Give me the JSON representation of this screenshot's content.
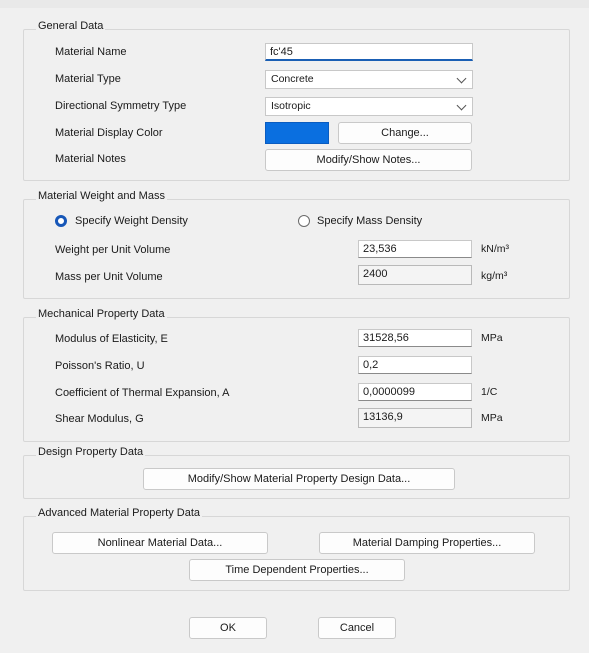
{
  "general": {
    "title": "General Data",
    "material_name_label": "Material Name",
    "material_name_value": "fc'45",
    "material_type_label": "Material Type",
    "material_type_value": "Concrete",
    "symmetry_label": "Directional Symmetry Type",
    "symmetry_value": "Isotropic",
    "display_color_label": "Material Display Color",
    "display_color": "#0a6fe0",
    "change_button": "Change...",
    "notes_label": "Material Notes",
    "notes_button": "Modify/Show Notes..."
  },
  "weight_mass": {
    "title": "Material Weight and Mass",
    "radio_weight": "Specify Weight Density",
    "radio_mass": "Specify Mass Density",
    "weight_label": "Weight per Unit Volume",
    "weight_value": "23,536",
    "weight_unit": "kN/m³",
    "mass_label": "Mass per Unit Volume",
    "mass_value": "2400",
    "mass_unit": "kg/m³"
  },
  "mechanical": {
    "title": "Mechanical Property Data",
    "e_label": "Modulus of Elasticity,  E",
    "e_value": "31528,56",
    "e_unit": "MPa",
    "u_label": "Poisson's Ratio,  U",
    "u_value": "0,2",
    "a_label": "Coefficient of Thermal Expansion,  A",
    "a_value": "0,0000099",
    "a_unit": "1/C",
    "g_label": "Shear Modulus,  G",
    "g_value": "13136,9",
    "g_unit": "MPa"
  },
  "design": {
    "title": "Design Property Data",
    "button": "Modify/Show Material Property Design Data..."
  },
  "advanced": {
    "title": "Advanced Material Property Data",
    "nonlinear_button": "Nonlinear Material Data...",
    "damping_button": "Material Damping Properties...",
    "time_button": "Time Dependent Properties..."
  },
  "footer": {
    "ok": "OK",
    "cancel": "Cancel"
  }
}
